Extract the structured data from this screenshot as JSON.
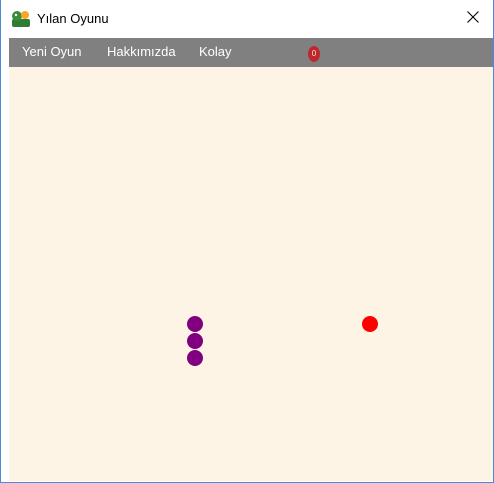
{
  "window": {
    "title": "Yılan Oyunu",
    "app_icon": "snake-app-icon",
    "close_icon": "close-icon"
  },
  "menu": {
    "items": [
      {
        "label": "Yeni Oyun"
      },
      {
        "label": "Hakkımızda"
      },
      {
        "label": "Kolay"
      }
    ]
  },
  "score": {
    "value": "0",
    "color": "#c0272d"
  },
  "game": {
    "board_color": "#fdf4e5",
    "snake_color": "#800080",
    "food_color": "#ff0000",
    "snake_segments": 3,
    "food_count": 1
  }
}
